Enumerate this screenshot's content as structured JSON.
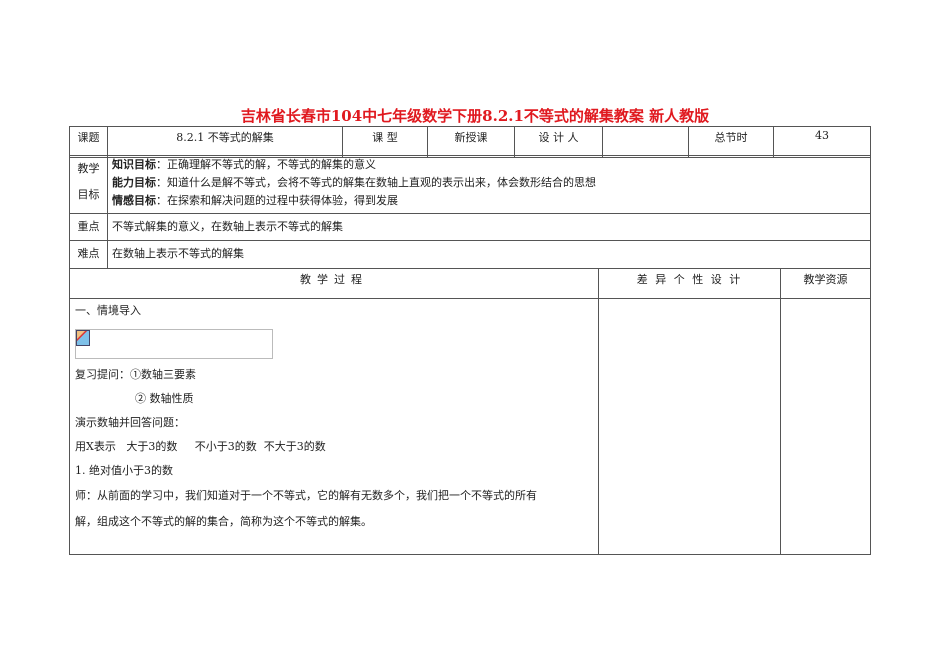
{
  "title": "吉林省长春市104中七年级数学下册8.2.1不等式的解集教案 新人教版",
  "header": {
    "topic_label": "课题",
    "topic": "8.2.1 不等式的解集",
    "type_label": "课  型",
    "type": "新授课",
    "designer_label": "设 计 人",
    "designer": "",
    "hours_label": "总节时",
    "hours": "43"
  },
  "goals": {
    "label1": "教学",
    "label2": "目标",
    "items": [
      {
        "name": "知识目标",
        "text": "：正确理解不等式的解，不等式的解集的意义"
      },
      {
        "name": "能力目标",
        "text": "：知道什么是解不等式，会将不等式的解集在数轴上直观的表示出来，体会数形结合的思想"
      },
      {
        "name": "情感目标",
        "text": "：在探索和解决问题的过程中获得体验，得到发展"
      }
    ]
  },
  "key": {
    "label": "重点",
    "text": "不等式解集的意义，在数轴上表示不等式的解集"
  },
  "difficulty": {
    "label": "难点",
    "text": "在数轴上表示不等式的解集"
  },
  "process": {
    "col1": "教学过程",
    "col2": "差 异 个 性 设 计",
    "col3": "教学资源",
    "lines": [
      "一、情境导入",
      "复习提问：①数轴三要素",
      "② 数轴性质",
      "演示数轴并回答问题：",
      "用X表示   大于3的数     不小于3的数  不大于3的数",
      "1.  绝对值小于3的数",
      "师：从前面的学习中，我们知道对于一个不等式，它的解有无数多个，我们把一个不等式的所有",
      "解，组成这个不等式的解的集合，简称为这个不等式的解集。"
    ]
  }
}
